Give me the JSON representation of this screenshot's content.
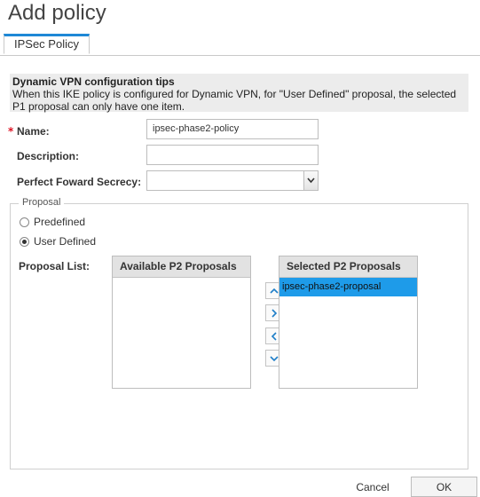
{
  "dialog": {
    "title": "Add policy"
  },
  "tabs": [
    {
      "label": "IPSec Policy"
    }
  ],
  "tips": {
    "title": "Dynamic VPN configuration tips",
    "text": "When this IKE policy is configured for Dynamic VPN, for \"User Defined\" proposal, the selected P1 proposal can only have one item."
  },
  "form": {
    "name": {
      "required_marker": "*",
      "label": "Name:",
      "value": "ipsec-phase2-policy"
    },
    "description": {
      "label": "Description:",
      "value": ""
    },
    "pfs": {
      "label": "Perfect Foward Secrecy:",
      "value": ""
    }
  },
  "proposal": {
    "legend": "Proposal",
    "options": [
      {
        "label": "Predefined",
        "checked": false
      },
      {
        "label": "User Defined",
        "checked": true
      }
    ],
    "list_label": "Proposal List:",
    "available": {
      "header": "Available P2 Proposals",
      "items": []
    },
    "selected": {
      "header": "Selected P2 Proposals",
      "items": [
        "ipsec-phase2-proposal"
      ]
    }
  },
  "footer": {
    "cancel_label": "Cancel",
    "ok_label": "OK"
  },
  "colors": {
    "accent": "#1e88d6",
    "selection": "#1e9be9",
    "required": "#dd1122"
  }
}
